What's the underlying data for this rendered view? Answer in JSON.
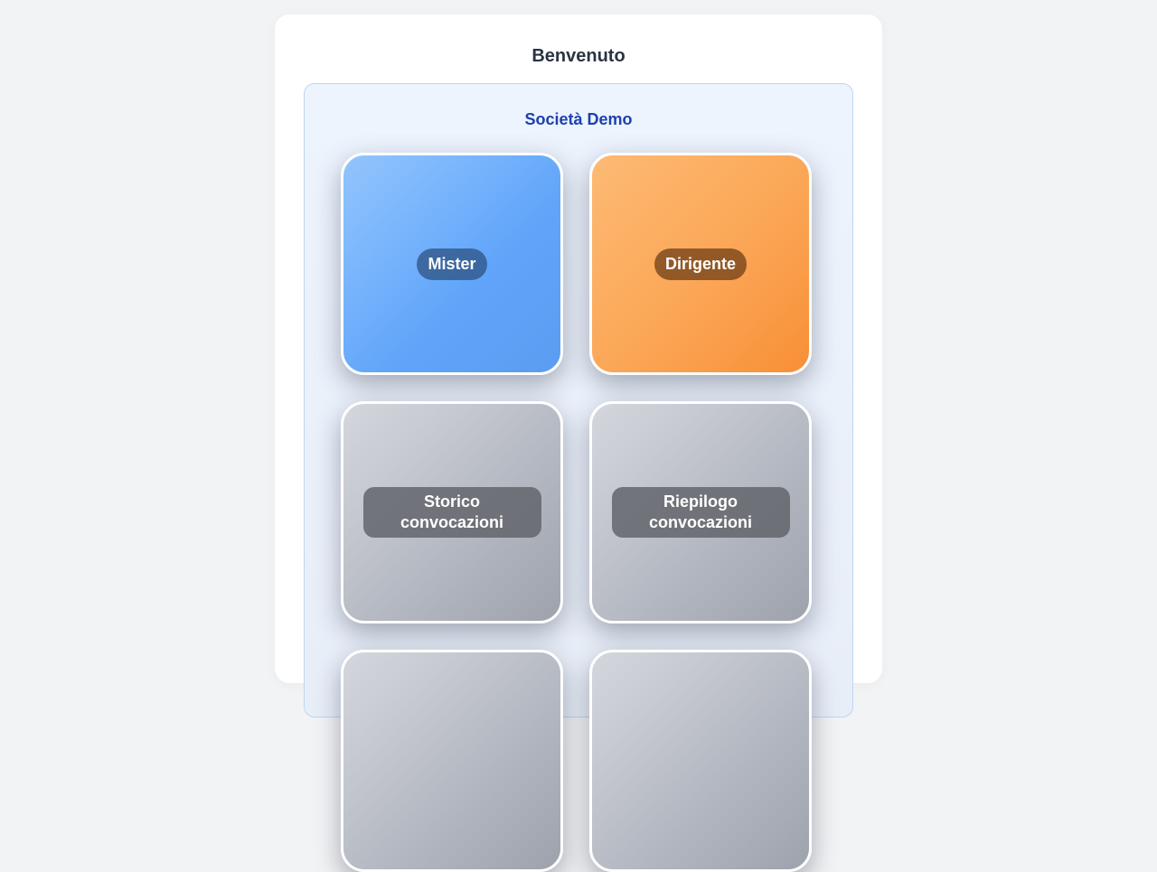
{
  "header": {
    "title": "Benvenuto"
  },
  "society": {
    "name": "Società Demo"
  },
  "tiles": [
    {
      "label": "Mister",
      "color": "#60a5fa"
    },
    {
      "label": "Dirigente",
      "color": "#fb923c"
    },
    {
      "label": "Storico convocazioni",
      "color": "#9ca3af"
    },
    {
      "label": "Riepilogo convocazioni",
      "color": "#9ca3af"
    }
  ]
}
